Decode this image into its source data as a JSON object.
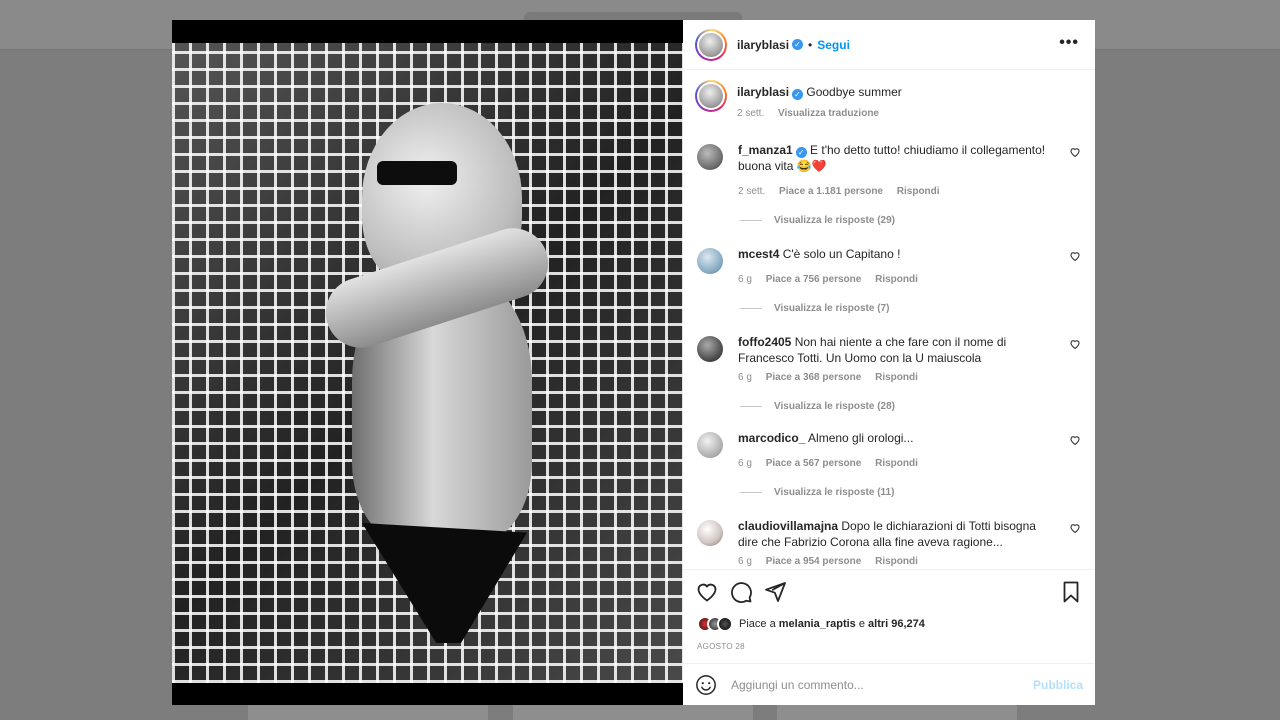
{
  "post": {
    "username": "ilaryblasi",
    "follow_label": "Segui",
    "more_label": "•••",
    "caption": "Goodbye summer",
    "caption_time": "2 sett.",
    "translate_label": "Visualizza traduzione"
  },
  "comments": [
    {
      "user": "f_manza1",
      "verified": true,
      "text": "E t'ho detto tutto! chiudiamo il collegamento! buona vita 😂❤️",
      "time": "2 sett.",
      "likes": "Piace a 1.181 persone",
      "reply": "Rispondi",
      "replies": "Visualizza le risposte (29)"
    },
    {
      "user": "mcest4",
      "verified": false,
      "text": "C'è solo un Capitano !",
      "time": "6 g",
      "likes": "Piace a 756 persone",
      "reply": "Rispondi",
      "replies": "Visualizza le risposte (7)"
    },
    {
      "user": "foffo2405",
      "verified": false,
      "text": "Non hai niente a che fare con il nome di Francesco Totti. Un Uomo con la U maiuscola",
      "time": "6 g",
      "likes": "Piace a 368 persone",
      "reply": "Rispondi",
      "replies": "Visualizza le risposte (28)"
    },
    {
      "user": "marcodico_",
      "verified": false,
      "text": "Almeno gli orologi...",
      "time": "6 g",
      "likes": "Piace a 567 persone",
      "reply": "Rispondi",
      "replies": "Visualizza le risposte (11)"
    },
    {
      "user": "claudiovillamajna",
      "verified": false,
      "text": "Dopo le dichiarazioni di Totti bisogna dire che Fabrizio Corona alla fine aveva ragione...",
      "time": "6 g",
      "likes": "Piace a 954 persone",
      "reply": "Rispondi",
      "replies": ""
    }
  ],
  "likes": {
    "prefix": "Piace a ",
    "user": "melania_raptis",
    "middle": " e ",
    "others": "altri 96,274"
  },
  "date": "AGOSTO 28",
  "add_comment": {
    "placeholder": "Aggiungi un commento...",
    "publish_label": "Pubblica"
  },
  "colors": {
    "accent": "#0095f6",
    "verified": "#3897f0",
    "heart": "#ed4956"
  }
}
